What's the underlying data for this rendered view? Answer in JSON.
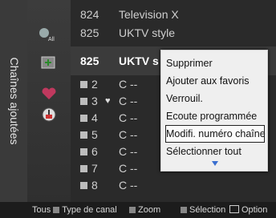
{
  "sidebar": {
    "title": "Chaînes ajoutées"
  },
  "icons": {
    "all": {
      "name": "all-channels-icon",
      "label": "All"
    },
    "add": {
      "name": "added-channels-icon"
    },
    "fav": {
      "name": "favorites-heart-icon"
    },
    "lock": {
      "name": "programmed-clock-icon"
    }
  },
  "channels": [
    {
      "num": "824",
      "name": "Television X"
    },
    {
      "num": "825",
      "name": "UKTV style"
    },
    {
      "num": "825",
      "name": "UKTV s"
    }
  ],
  "subchannels": [
    {
      "num": "2",
      "name": "C --",
      "fav": false
    },
    {
      "num": "3",
      "name": "C --",
      "fav": true
    },
    {
      "num": "4",
      "name": "C --",
      "fav": false
    },
    {
      "num": "5",
      "name": "C --",
      "fav": false
    },
    {
      "num": "6",
      "name": "C --",
      "fav": false
    },
    {
      "num": "7",
      "name": "C --",
      "fav": false
    },
    {
      "num": "8",
      "name": "C --",
      "fav": false
    }
  ],
  "menu": {
    "items": [
      "Supprimer",
      "Ajouter aux favoris",
      "Verrouil.",
      "Ecoute programmée",
      "Modifi. numéro chaîne",
      "Sélectionner tout"
    ],
    "selected_index": 4
  },
  "bottom": {
    "tous_prefix": "Tous",
    "type_canal": "Type de canal",
    "zoom": "Zoom",
    "selection": "Sélection",
    "option": "Option",
    "colors": {
      "red": "#c0392b",
      "green": "#4caf50",
      "yellow": "#e0c020",
      "blue": "#3a6fd0"
    }
  }
}
